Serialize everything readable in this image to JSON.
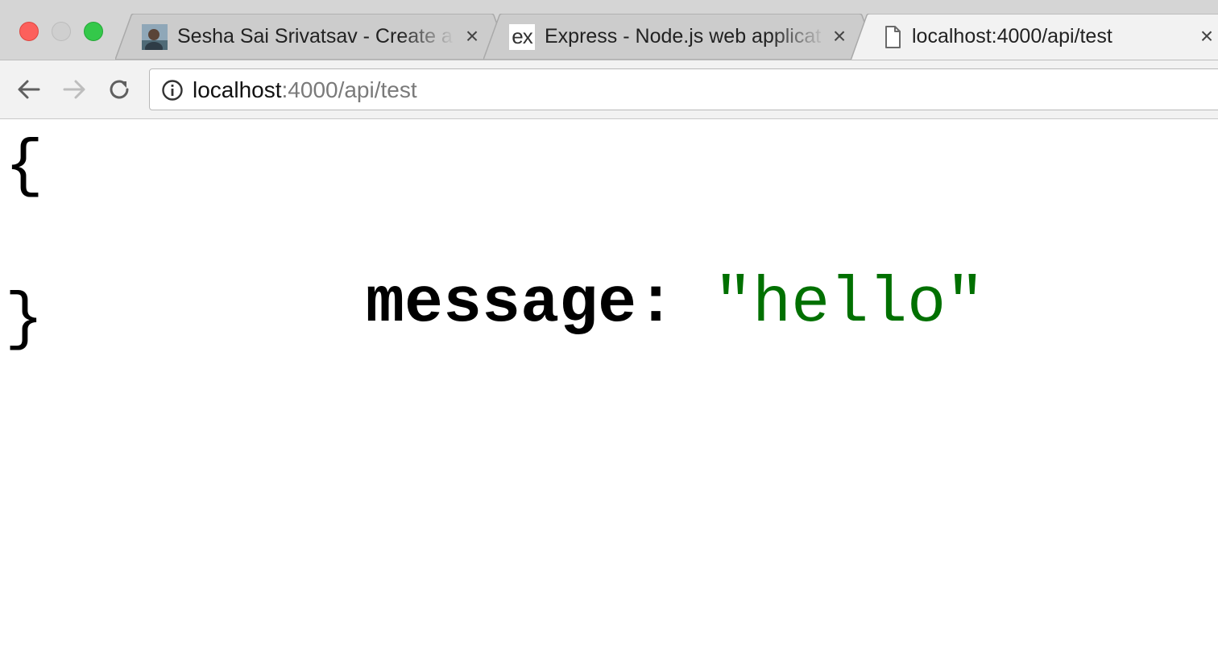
{
  "browser": {
    "tabs": [
      {
        "title": "Sesha Sai Srivatsav - Create a",
        "favicon": "user-avatar-icon",
        "active": false
      },
      {
        "title": "Express - Node.js web applicat",
        "favicon": "express-logo-icon",
        "favicon_text": "ex",
        "active": false
      },
      {
        "title": "localhost:4000/api/test",
        "favicon": "document-icon",
        "active": true
      }
    ],
    "tab_close_glyph": "×",
    "address_bar": {
      "host": "localhost",
      "rest": ":4000/api/test"
    }
  },
  "json_view": {
    "open_brace": "{",
    "key": "message:",
    "value": "\"hello\"",
    "close_brace": "}"
  },
  "colors": {
    "string_value": "#007000",
    "tab_strip": "#d5d5d5",
    "active_tab": "#f2f2f2"
  }
}
